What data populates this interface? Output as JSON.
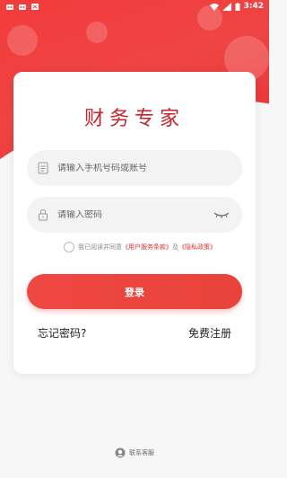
{
  "status_bar": {
    "time": "3:42",
    "icons": [
      "app-notification-icon",
      "app-notification-icon",
      "close-box-icon",
      "wifi-icon",
      "signal-icon",
      "battery-icon"
    ]
  },
  "app": {
    "title": "财务专家"
  },
  "login_form": {
    "account_placeholder": "请输入手机号码或账号",
    "password_placeholder": "请输入密码",
    "agreement_prefix": "我已阅读并同意",
    "user_agreement": "《用户服务条款》",
    "agreement_and": "及",
    "privacy_policy": "《隐私政策》",
    "login_label": "登录",
    "forgot_password": "忘记密码?",
    "register": "免费注册"
  },
  "footer": {
    "contact": "联系客服"
  },
  "colors": {
    "brand_red": "#ef4743",
    "title_red": "#c8232c"
  }
}
